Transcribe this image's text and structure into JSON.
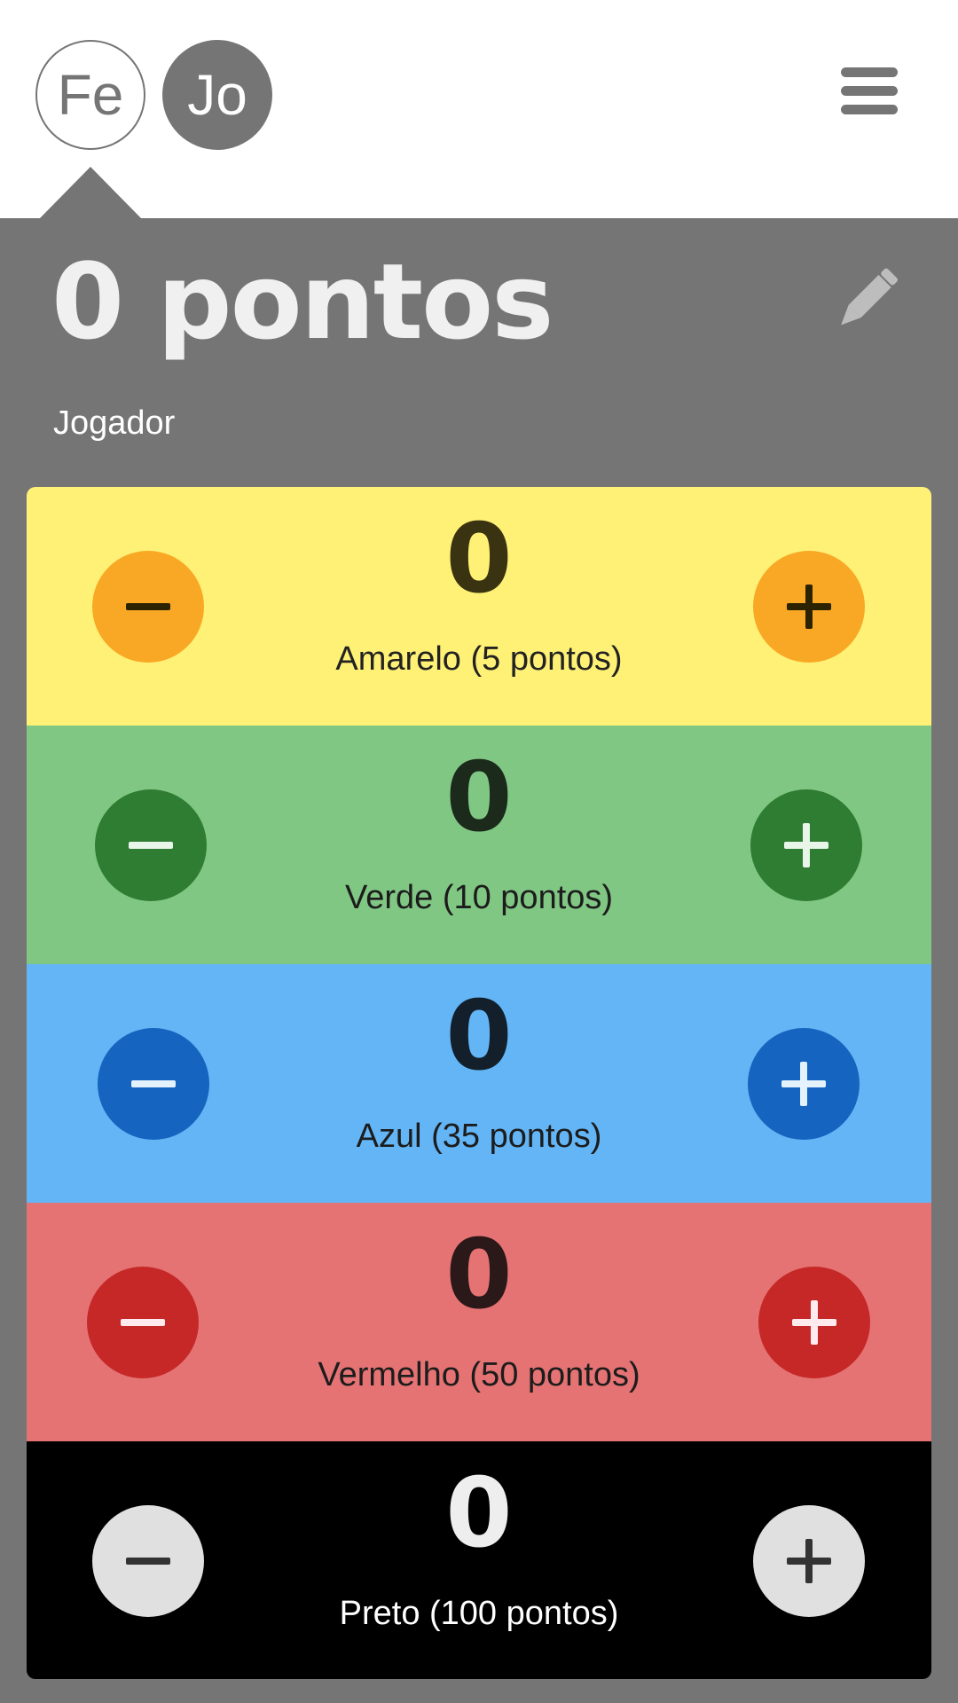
{
  "players": [
    {
      "initials": "Fe",
      "selected": true
    },
    {
      "initials": "Jo",
      "selected": false
    }
  ],
  "icons": {
    "menu": "hamburger-menu-icon",
    "edit": "pencil-icon",
    "decrement": "minus-icon",
    "increment": "plus-icon"
  },
  "score": {
    "title": "0 pontos",
    "player_name": "Jogador"
  },
  "rows": [
    {
      "count": "0",
      "label": "Amarelo (5 pontos)",
      "bg": "#fff176",
      "button": "#f9a825",
      "glyph": "#2b2200",
      "count_color": "#3a3311",
      "label_color": "#222222"
    },
    {
      "count": "0",
      "label": "Verde (10 pontos)",
      "bg": "#81c784",
      "button": "#2e7d32",
      "glyph": "#e8f5e9",
      "count_color": "#1b2a1b",
      "label_color": "#1c1c1c"
    },
    {
      "count": "0",
      "label": "Azul (35 pontos)",
      "bg": "#64b5f6",
      "button": "#1565c0",
      "glyph": "#e3f2fd",
      "count_color": "#13202b",
      "label_color": "#1c1c1c"
    },
    {
      "count": "0",
      "label": "Vermelho (50 pontos)",
      "bg": "#e57373",
      "button": "#c62828",
      "glyph": "#ffebee",
      "count_color": "#2b1818",
      "label_color": "#1c1c1c"
    },
    {
      "count": "0",
      "label": "Preto (100 pontos)",
      "bg": "#000000",
      "button": "#e0e0e0",
      "glyph": "#333333",
      "count_color": "#eeeeee",
      "label_color": "#ffffff"
    }
  ]
}
